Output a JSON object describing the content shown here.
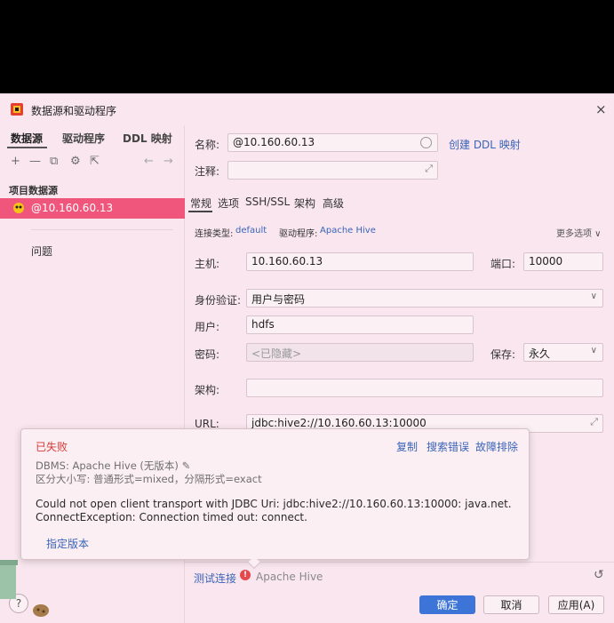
{
  "window": {
    "title": "数据源和驱动程序",
    "close": "×"
  },
  "left": {
    "tabs": [
      "数据源",
      "驱动程序",
      "DDL 映射"
    ],
    "toolbar": {
      "add": "+",
      "remove": "—",
      "copy": "⧉",
      "settings": "⚙",
      "export": "⇱",
      "back": "←",
      "forward": "→"
    },
    "section": "项目数据源",
    "selected_item": "@10.160.60.13",
    "issues": "问题"
  },
  "right": {
    "name_label": "名称:",
    "name_value": "@10.160.60.13",
    "create_ddl": "创建 DDL 映射",
    "comment_label": "注释:",
    "tabs": [
      "常规",
      "选项",
      "SSH/SSL",
      "架构",
      "高级"
    ],
    "conn_type_label": "连接类型:",
    "conn_type_value": "default",
    "driver_label": "驱动程序:",
    "driver_value": "Apache Hive",
    "more_options": "更多选项 ∨",
    "host_label": "主机:",
    "host_value": "10.160.60.13",
    "port_label": "端口:",
    "port_value": "10000",
    "auth_label": "身份验证:",
    "auth_value": "用户与密码",
    "user_label": "用户:",
    "user_value": "hdfs",
    "password_label": "密码:",
    "password_placeholder": "<已隐藏>",
    "save_label": "保存:",
    "save_value": "永久",
    "schema_label": "架构:",
    "url_label": "URL:",
    "url_value": "jdbc:hive2://10.160.60.13:10000"
  },
  "popup": {
    "title": "已失败",
    "copy": "复制",
    "search_error": "搜索错误",
    "troubleshoot": "故障排除",
    "dbms": "DBMS: Apache Hive (无版本)",
    "case": "区分大小写: 普通形式=mixed，分隔形式=exact",
    "message_line1": "Could not open client transport with JDBC Uri: jdbc:hive2://10.160.60.13:10000: java.net.",
    "message_line2": "ConnectException: Connection timed out: connect.",
    "specify_version": "指定版本"
  },
  "footer": {
    "test_connection": "测试连接",
    "driver_name": "Apache Hive",
    "ok": "确定",
    "cancel": "取消",
    "apply": "应用(A)",
    "help": "?"
  },
  "colors": {
    "selected": "#f0567b",
    "primary": "#3d74d8",
    "error": "#d63a36",
    "link": "#3a64b9",
    "background": "#f9e6ee"
  }
}
